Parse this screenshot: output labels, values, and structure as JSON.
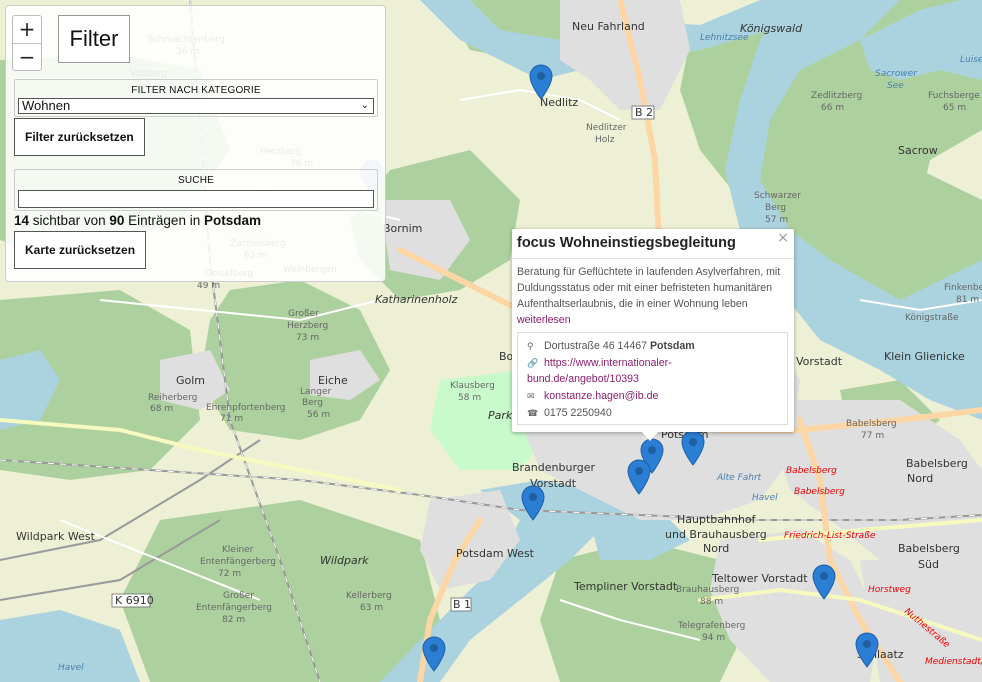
{
  "map": {
    "labels": [
      {
        "t": "Neu Fahrland",
        "k": "ml"
      },
      {
        "t": "Königswald",
        "k": "ml ml-it"
      },
      {
        "t": "Nedlitz",
        "k": "ml"
      },
      {
        "t": "Sacrow",
        "k": "ml"
      },
      {
        "t": "Bornim",
        "k": "ml"
      },
      {
        "t": "Katharinenholz",
        "k": "ml ml-it"
      },
      {
        "t": "Golm",
        "k": "ml"
      },
      {
        "t": "Eiche",
        "k": "ml"
      },
      {
        "t": "Brandenburger",
        "k": "ml"
      },
      {
        "t": "Vorstadt",
        "k": "ml"
      },
      {
        "t": "Potsdam West",
        "k": "ml"
      },
      {
        "t": "Wildpark West",
        "k": "ml"
      },
      {
        "t": "Wildpark",
        "k": "ml ml-it"
      },
      {
        "t": "Templiner Vorstadt",
        "k": "ml"
      },
      {
        "t": "Teltower Vorstadt",
        "k": "ml"
      },
      {
        "t": "Hauptbahnhof",
        "k": "ml"
      },
      {
        "t": "und Brauhausberg",
        "k": "ml"
      },
      {
        "t": "Nord",
        "k": "ml"
      },
      {
        "t": "Babelsberg",
        "k": "ml"
      },
      {
        "t": "Nord",
        "k": "ml"
      },
      {
        "t": "Babelsberg",
        "k": "ml"
      },
      {
        "t": "Süd",
        "k": "ml"
      },
      {
        "t": "Klein Glienicke",
        "k": "ml"
      },
      {
        "t": "Vorstadt",
        "k": "ml"
      },
      {
        "t": "Schlaatz",
        "k": "ml"
      },
      {
        "t": "Bo",
        "k": "ml"
      },
      {
        "t": "Potsdam",
        "k": "ml"
      },
      {
        "t": "Park",
        "k": "ml ml-it"
      },
      {
        "t": "Havel",
        "k": "ml-water"
      },
      {
        "t": "Lehnitzsee",
        "k": "ml-water"
      },
      {
        "t": "Sacrower",
        "k": "ml-water"
      },
      {
        "t": "See",
        "k": "ml-water"
      },
      {
        "t": "Luise",
        "k": "ml-water"
      },
      {
        "t": "Zedlitzberg",
        "k": "ml-elev"
      },
      {
        "t": "66 m",
        "k": "ml-elev"
      },
      {
        "t": "Fuchsberge",
        "k": "ml-elev"
      },
      {
        "t": "65 m",
        "k": "ml-elev"
      },
      {
        "t": "Schwarzer",
        "k": "ml-elev"
      },
      {
        "t": "Berg",
        "k": "ml-elev"
      },
      {
        "t": "57 m",
        "k": "ml-elev"
      },
      {
        "t": "Nedlitzer",
        "k": "ml-elev"
      },
      {
        "t": "Holz",
        "k": "ml-elev"
      },
      {
        "t": "Großer",
        "k": "ml-elev"
      },
      {
        "t": "Herzberg",
        "k": "ml-elev"
      },
      {
        "t": "73 m",
        "k": "ml-elev"
      },
      {
        "t": "Reiherberg",
        "k": "ml-elev"
      },
      {
        "t": "68 m",
        "k": "ml-elev"
      },
      {
        "t": "Ehrenpfortenberg",
        "k": "ml-elev"
      },
      {
        "t": "71 m",
        "k": "ml-elev"
      },
      {
        "t": "Langer",
        "k": "ml-elev"
      },
      {
        "t": "Berg",
        "k": "ml-elev"
      },
      {
        "t": "56 m",
        "k": "ml-elev"
      },
      {
        "t": "Klausberg",
        "k": "ml-elev"
      },
      {
        "t": "58 m",
        "k": "ml-elev"
      },
      {
        "t": "Kleiner",
        "k": "ml-elev"
      },
      {
        "t": "Entenfängerberg",
        "k": "ml-elev"
      },
      {
        "t": "72 m",
        "k": "ml-elev"
      },
      {
        "t": "Großer",
        "k": "ml-elev"
      },
      {
        "t": "Entenfängerberg",
        "k": "ml-elev"
      },
      {
        "t": "82 m",
        "k": "ml-elev"
      },
      {
        "t": "Kellerberg",
        "k": "ml-elev"
      },
      {
        "t": "63 m",
        "k": "ml-elev"
      },
      {
        "t": "Brauhausberg",
        "k": "ml-elev"
      },
      {
        "t": "88 m",
        "k": "ml-elev"
      },
      {
        "t": "Telegrafenberg",
        "k": "ml-elev"
      },
      {
        "t": "94 m",
        "k": "ml-elev"
      },
      {
        "t": "Babelsberg",
        "k": "ml-elev"
      },
      {
        "t": "77 m",
        "k": "ml-elev"
      },
      {
        "t": "Finkenberg",
        "k": "ml-elev"
      },
      {
        "t": "81 m",
        "k": "ml-elev"
      },
      {
        "t": "Schmachtenberg",
        "k": "ml-elev"
      },
      {
        "t": "36 m",
        "k": "ml-elev"
      },
      {
        "t": "Voßberg",
        "k": "ml-elev"
      },
      {
        "t": "Grube",
        "k": "ml-elev"
      },
      {
        "t": "Herzberg",
        "k": "ml-elev"
      },
      {
        "t": "76 m",
        "k": "ml-elev"
      },
      {
        "t": "Zachelsberg",
        "k": "ml-elev"
      },
      {
        "t": "62 m",
        "k": "ml-elev"
      },
      {
        "t": "Geiselberg",
        "k": "ml-elev"
      },
      {
        "t": "49 m",
        "k": "ml-elev"
      },
      {
        "t": "Weinbergen",
        "k": "ml-elev"
      },
      {
        "t": "Babelsberg",
        "k": "ml-road"
      },
      {
        "t": "Babelsberg",
        "k": "ml-road"
      },
      {
        "t": "Friedrich-List-Straße",
        "k": "ml-road"
      },
      {
        "t": "Horstweg",
        "k": "ml-road"
      },
      {
        "t": "Nuthestraße",
        "k": "ml-road"
      },
      {
        "t": "Medienstadt/Fi",
        "k": "ml-road"
      },
      {
        "t": "Königstraße",
        "k": "ml-elev"
      },
      {
        "t": "Alte Fahrt",
        "k": "ml-water"
      },
      {
        "t": "Havel",
        "k": "ml-water"
      }
    ],
    "road_shields": [
      "B 2",
      "B 1",
      "K 6910"
    ]
  },
  "controls": {
    "zoom_in": "+",
    "zoom_out": "−",
    "filter_title": "Filter"
  },
  "panel": {
    "category_label": "FILTER NACH KATEGORIE",
    "category_selected": "Wohnen",
    "reset_filter_label": "Filter zurücksetzen",
    "search_label": "SUCHE",
    "search_value": "",
    "count_visible": "14",
    "count_text_1": "sichtbar von",
    "count_total": "90",
    "count_text_2": "Einträgen in",
    "count_city": "Potsdam",
    "reset_map_label": "Karte zurücksetzen"
  },
  "popup": {
    "title": "focus Wohneinstiegsbegleitung",
    "close": "×",
    "description": "Beratung für Geflüchtete in laufenden Asylverfahren, mit Duldungsstatus oder mit einer befristeten humanitären Aufenthaltserlaubnis, die in einer Wohnung leben",
    "read_more": "weiterlesen",
    "address_street": "Dortustraße 46 14467",
    "address_city": "Potsdam",
    "url_line1": "https://www.internationaler-",
    "url_line2": "bund.de/angebot/10393",
    "email": "konstanze.hagen@ib.de",
    "phone": "0175 2250940"
  },
  "colors": {
    "marker": "#2a7fd4",
    "link": "#8a1f6e",
    "forest": "#add19e",
    "water": "#aad3df",
    "urban": "#e0dfdf",
    "farmland": "#eef0d5"
  },
  "markers": {
    "count": 7,
    "icon": "map-marker-icon"
  }
}
